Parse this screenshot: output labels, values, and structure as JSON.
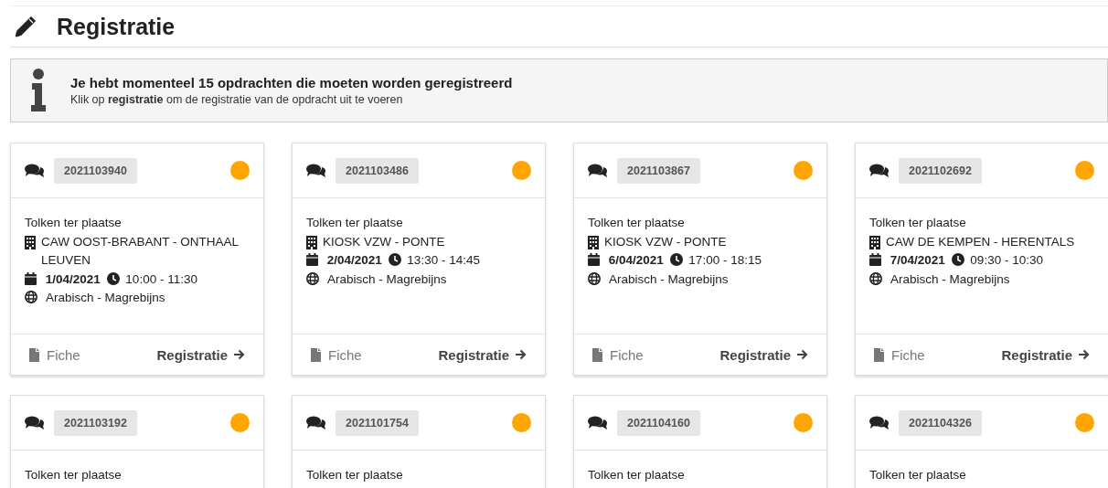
{
  "page": {
    "title": "Registratie"
  },
  "notice": {
    "heading": "Je hebt momenteel 15 opdrachten die moeten worden geregistreerd",
    "text": "Klik op **registratie** om de registratie van de opdracht uit te voeren"
  },
  "cards": [
    {
      "number": "2021103940",
      "color": "#ffa500",
      "type": "Tolken ter plaatse",
      "location": "CAW OOST-BRABANT - ONTHAAL LEUVEN",
      "date": "1/04/2021",
      "time": "10:00 - 11:30",
      "language": "Arabisch - Magrebijns",
      "fiche": "Fiche",
      "action": "Registratie"
    },
    {
      "number": "2021103486",
      "color": "#ffa500",
      "type": "Tolken ter plaatse",
      "location": "KIOSK VZW - PONTE",
      "date": "2/04/2021",
      "time": "13:30 - 14:45",
      "language": "Arabisch - Magrebijns",
      "fiche": "Fiche",
      "action": "Registratie"
    },
    {
      "number": "2021103867",
      "color": "#ffa500",
      "type": "Tolken ter plaatse",
      "location": "KIOSK VZW - PONTE",
      "date": "6/04/2021",
      "time": "17:00 - 18:15",
      "language": "Arabisch - Magrebijns",
      "fiche": "Fiche",
      "action": "Registratie"
    },
    {
      "number": "2021102692",
      "color": "#ffa500",
      "type": "Tolken ter plaatse",
      "location": "CAW DE KEMPEN - HERENTALS",
      "date": "7/04/2021",
      "time": "09:30 - 10:30",
      "language": "Arabisch - Magrebijns",
      "fiche": "Fiche",
      "action": "Registratie"
    },
    {
      "number": "2021103192",
      "color": "#ffa500",
      "type": "Tolken ter plaatse"
    },
    {
      "number": "2021101754",
      "color": "#ffa500",
      "type": "Tolken ter plaatse"
    },
    {
      "number": "2021104160",
      "color": "#ffa500",
      "type": "Tolken ter plaatse"
    },
    {
      "number": "2021104326",
      "color": "#ffa500",
      "type": "Tolken ter plaatse"
    }
  ]
}
